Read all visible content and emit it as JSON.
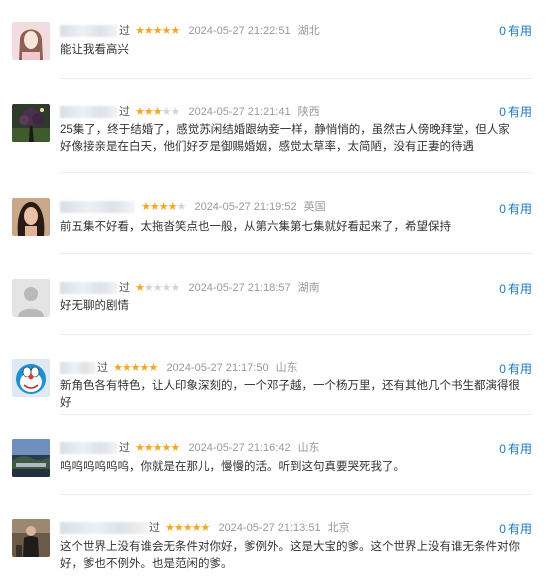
{
  "comments": [
    {
      "name_tail": "过",
      "stars": 5,
      "time": "2024-05-27 21:22:51",
      "location": "湖北",
      "useful_count": "0",
      "useful_label": "有用",
      "text": "能让我看高兴",
      "avatar": "woman-portrait-avatar"
    },
    {
      "name_tail": "过",
      "stars": 3,
      "time": "2024-05-27 21:21:41",
      "location": "陕西",
      "useful_count": "0",
      "useful_label": "有用",
      "text": "25集了，终于结婚了，感觉苏闲结婚跟纳妾一样，静悄悄的，虽然古人傍晚拜堂，但人家好像接亲是在白天，他们好歹是御赐婚姻，感觉太草率，太简陋，没有正妻的待遇",
      "avatar": "fantasy-tree-avatar"
    },
    {
      "name_tail": "",
      "stars": 4,
      "time": "2024-05-27 21:19:52",
      "location": "英国",
      "useful_count": "0",
      "useful_label": "有用",
      "text": "前五集不好看，太拖沓笑点也一般，从第六集第七集就好看起来了，希望保持",
      "avatar": "woman-dark-hair-avatar"
    },
    {
      "name_tail": "过",
      "stars": 1,
      "time": "2024-05-27 21:18:57",
      "location": "湖南",
      "useful_count": "0",
      "useful_label": "有用",
      "text": "好无聊的剧情",
      "avatar": "default-user-avatar"
    },
    {
      "name_tail": "过",
      "stars": 5,
      "time": "2024-05-27 21:17:50",
      "location": "山东",
      "useful_count": "0",
      "useful_label": "有用",
      "text": "新角色各有特色，让人印象深刻的，一个邓子越，一个杨万里，还有其他几个书生都演得很好",
      "avatar": "doraemon-avatar"
    },
    {
      "name_tail": "过",
      "stars": 5,
      "time": "2024-05-27 21:16:42",
      "location": "山东",
      "useful_count": "0",
      "useful_label": "有用",
      "text": "呜呜呜呜呜呜，你就是在那儿，慢慢的活。听到这句真要哭死我了。",
      "avatar": "landscape-avatar"
    },
    {
      "name_tail": "过",
      "stars": 5,
      "time": "2024-05-27 21:13:51",
      "location": "北京",
      "useful_count": "0",
      "useful_label": "有用",
      "text": "这个世界上没有谁会无条件对你好，爹例外。这是大宝的爹。这个世界上没有谁无条件对你好，爹也不例外。也是范闲的爹。",
      "avatar": "man-standing-avatar"
    }
  ]
}
